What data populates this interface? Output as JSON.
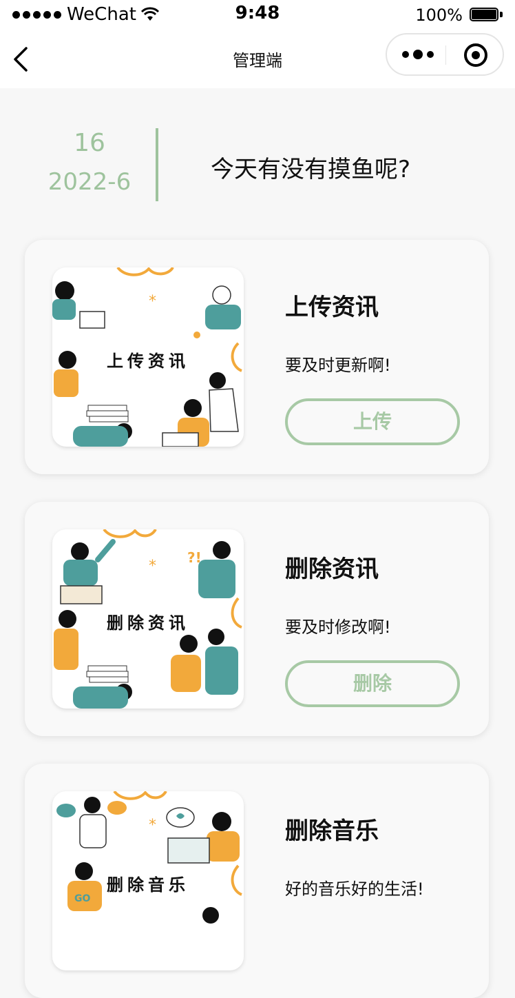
{
  "status_bar": {
    "carrier": "WeChat",
    "time": "9:48",
    "battery": "100%"
  },
  "nav": {
    "title": "管理端",
    "back_icon": "chevron-left-icon",
    "more_icon": "more-dots-icon",
    "close_icon": "target-circle-icon"
  },
  "date": {
    "day": "16",
    "year_month": "2022-6"
  },
  "greeting": "今天有没有摸鱼呢?",
  "colors": {
    "accent": "#9ec39d",
    "button_border": "#a7c9a5",
    "teal": "#4e9e9c",
    "orange": "#f2a93b"
  },
  "cards": [
    {
      "title": "上传资讯",
      "description": "要及时更新啊!",
      "button": "上传",
      "image_caption": "上传资讯"
    },
    {
      "title": "删除资讯",
      "description": "要及时修改啊!",
      "button": "删除",
      "image_caption": "删除资讯"
    },
    {
      "title": "删除音乐",
      "description": "好的音乐好的生活!",
      "image_caption": "删除音乐"
    }
  ]
}
